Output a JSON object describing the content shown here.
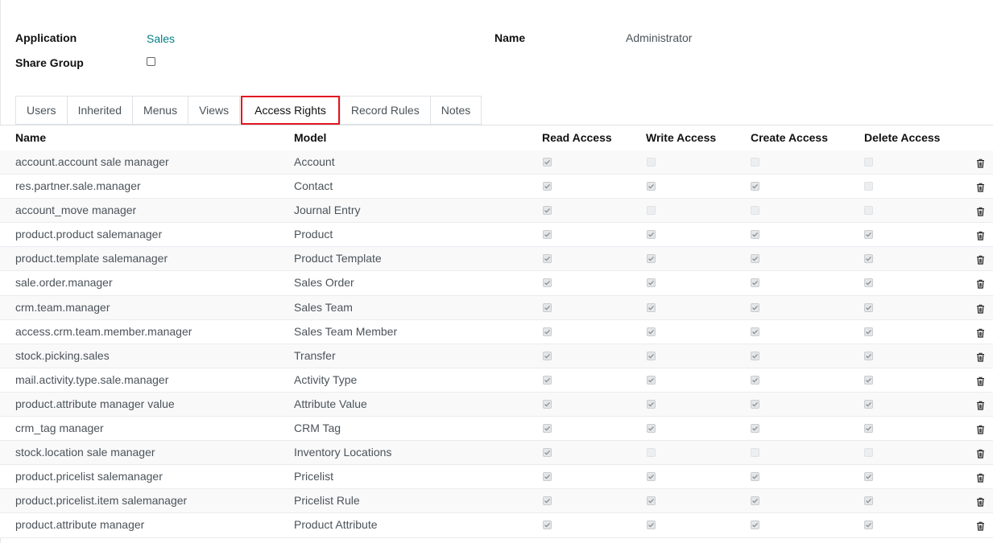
{
  "header": {
    "application_label": "Application",
    "application_value": "Sales",
    "share_group_label": "Share Group",
    "share_group_checked": false,
    "name_label": "Name",
    "name_value": "Administrator"
  },
  "tabs": [
    {
      "label": "Users",
      "active": false
    },
    {
      "label": "Inherited",
      "active": false
    },
    {
      "label": "Menus",
      "active": false
    },
    {
      "label": "Views",
      "active": false
    },
    {
      "label": "Access Rights",
      "active": true
    },
    {
      "label": "Record Rules",
      "active": false
    },
    {
      "label": "Notes",
      "active": false
    }
  ],
  "table": {
    "columns": [
      "Name",
      "Model",
      "Read Access",
      "Write Access",
      "Create Access",
      "Delete Access"
    ],
    "rows": [
      {
        "name": "account.account sale manager",
        "model": "Account",
        "read": true,
        "write": false,
        "create": false,
        "delete": false
      },
      {
        "name": "res.partner.sale.manager",
        "model": "Contact",
        "read": true,
        "write": true,
        "create": true,
        "delete": false
      },
      {
        "name": "account_move manager",
        "model": "Journal Entry",
        "read": true,
        "write": false,
        "create": false,
        "delete": false
      },
      {
        "name": "product.product salemanager",
        "model": "Product",
        "read": true,
        "write": true,
        "create": true,
        "delete": true
      },
      {
        "name": "product.template salemanager",
        "model": "Product Template",
        "read": true,
        "write": true,
        "create": true,
        "delete": true
      },
      {
        "name": "sale.order.manager",
        "model": "Sales Order",
        "read": true,
        "write": true,
        "create": true,
        "delete": true
      },
      {
        "name": "crm.team.manager",
        "model": "Sales Team",
        "read": true,
        "write": true,
        "create": true,
        "delete": true
      },
      {
        "name": "access.crm.team.member.manager",
        "model": "Sales Team Member",
        "read": true,
        "write": true,
        "create": true,
        "delete": true
      },
      {
        "name": "stock.picking.sales",
        "model": "Transfer",
        "read": true,
        "write": true,
        "create": true,
        "delete": true
      },
      {
        "name": "mail.activity.type.sale.manager",
        "model": "Activity Type",
        "read": true,
        "write": true,
        "create": true,
        "delete": true
      },
      {
        "name": "product.attribute manager value",
        "model": "Attribute Value",
        "read": true,
        "write": true,
        "create": true,
        "delete": true
      },
      {
        "name": "crm_tag manager",
        "model": "CRM Tag",
        "read": true,
        "write": true,
        "create": true,
        "delete": true
      },
      {
        "name": "stock.location sale manager",
        "model": "Inventory Locations",
        "read": true,
        "write": false,
        "create": false,
        "delete": false
      },
      {
        "name": "product.pricelist salemanager",
        "model": "Pricelist",
        "read": true,
        "write": true,
        "create": true,
        "delete": true
      },
      {
        "name": "product.pricelist.item salemanager",
        "model": "Pricelist Rule",
        "read": true,
        "write": true,
        "create": true,
        "delete": true
      },
      {
        "name": "product.attribute manager",
        "model": "Product Attribute",
        "read": true,
        "write": true,
        "create": true,
        "delete": true
      }
    ]
  },
  "icons": {
    "check": "checkmark",
    "delete": "trash-icon"
  },
  "colors": {
    "link": "#017e84",
    "active_tab_outline": "#e0181f"
  }
}
